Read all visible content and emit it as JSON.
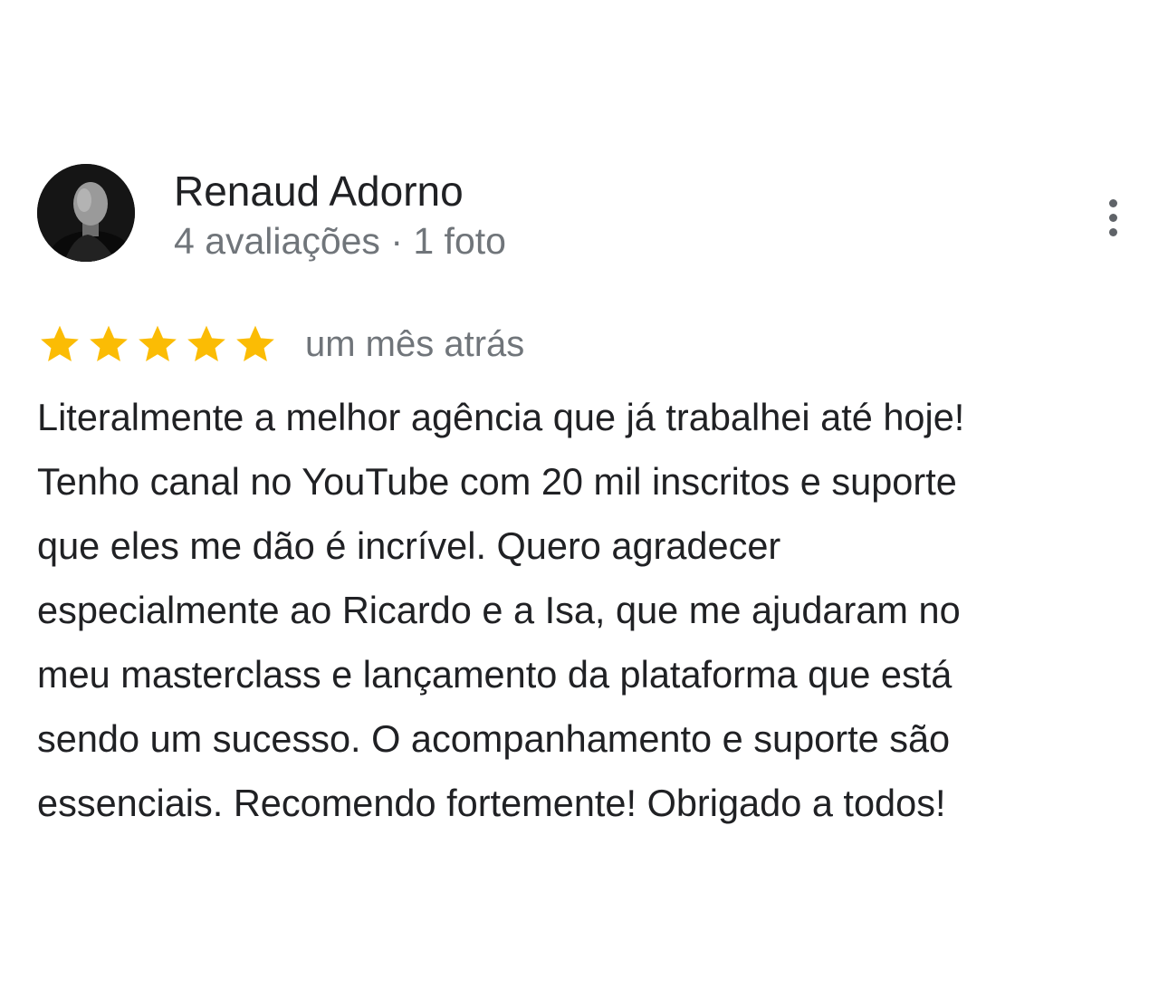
{
  "review": {
    "author": {
      "name": "Renaud Adorno",
      "meta": "4 avaliações · 1 foto",
      "avatar_icon": "profile-photo"
    },
    "menu_icon": "more-vert-icon",
    "rating": {
      "stars": 5,
      "max": 5,
      "star_icon": "star-icon",
      "star_color": "#fbbc04",
      "date": "um mês atrás"
    },
    "text_lines": [
      "Literalmente a melhor agência que já trabalhei até hoje!",
      "Tenho canal no YouTube com 20 mil inscritos e suporte",
      "que eles me dão é incrível. Quero agradecer",
      "especialmente ao Ricardo e a Isa, que me ajudaram no",
      "meu masterclass e lançamento da plataforma que está",
      "sendo um sucesso. O acompanhamento e suporte são",
      "essenciais. Recomendo fortemente! Obrigado a todos!"
    ]
  }
}
